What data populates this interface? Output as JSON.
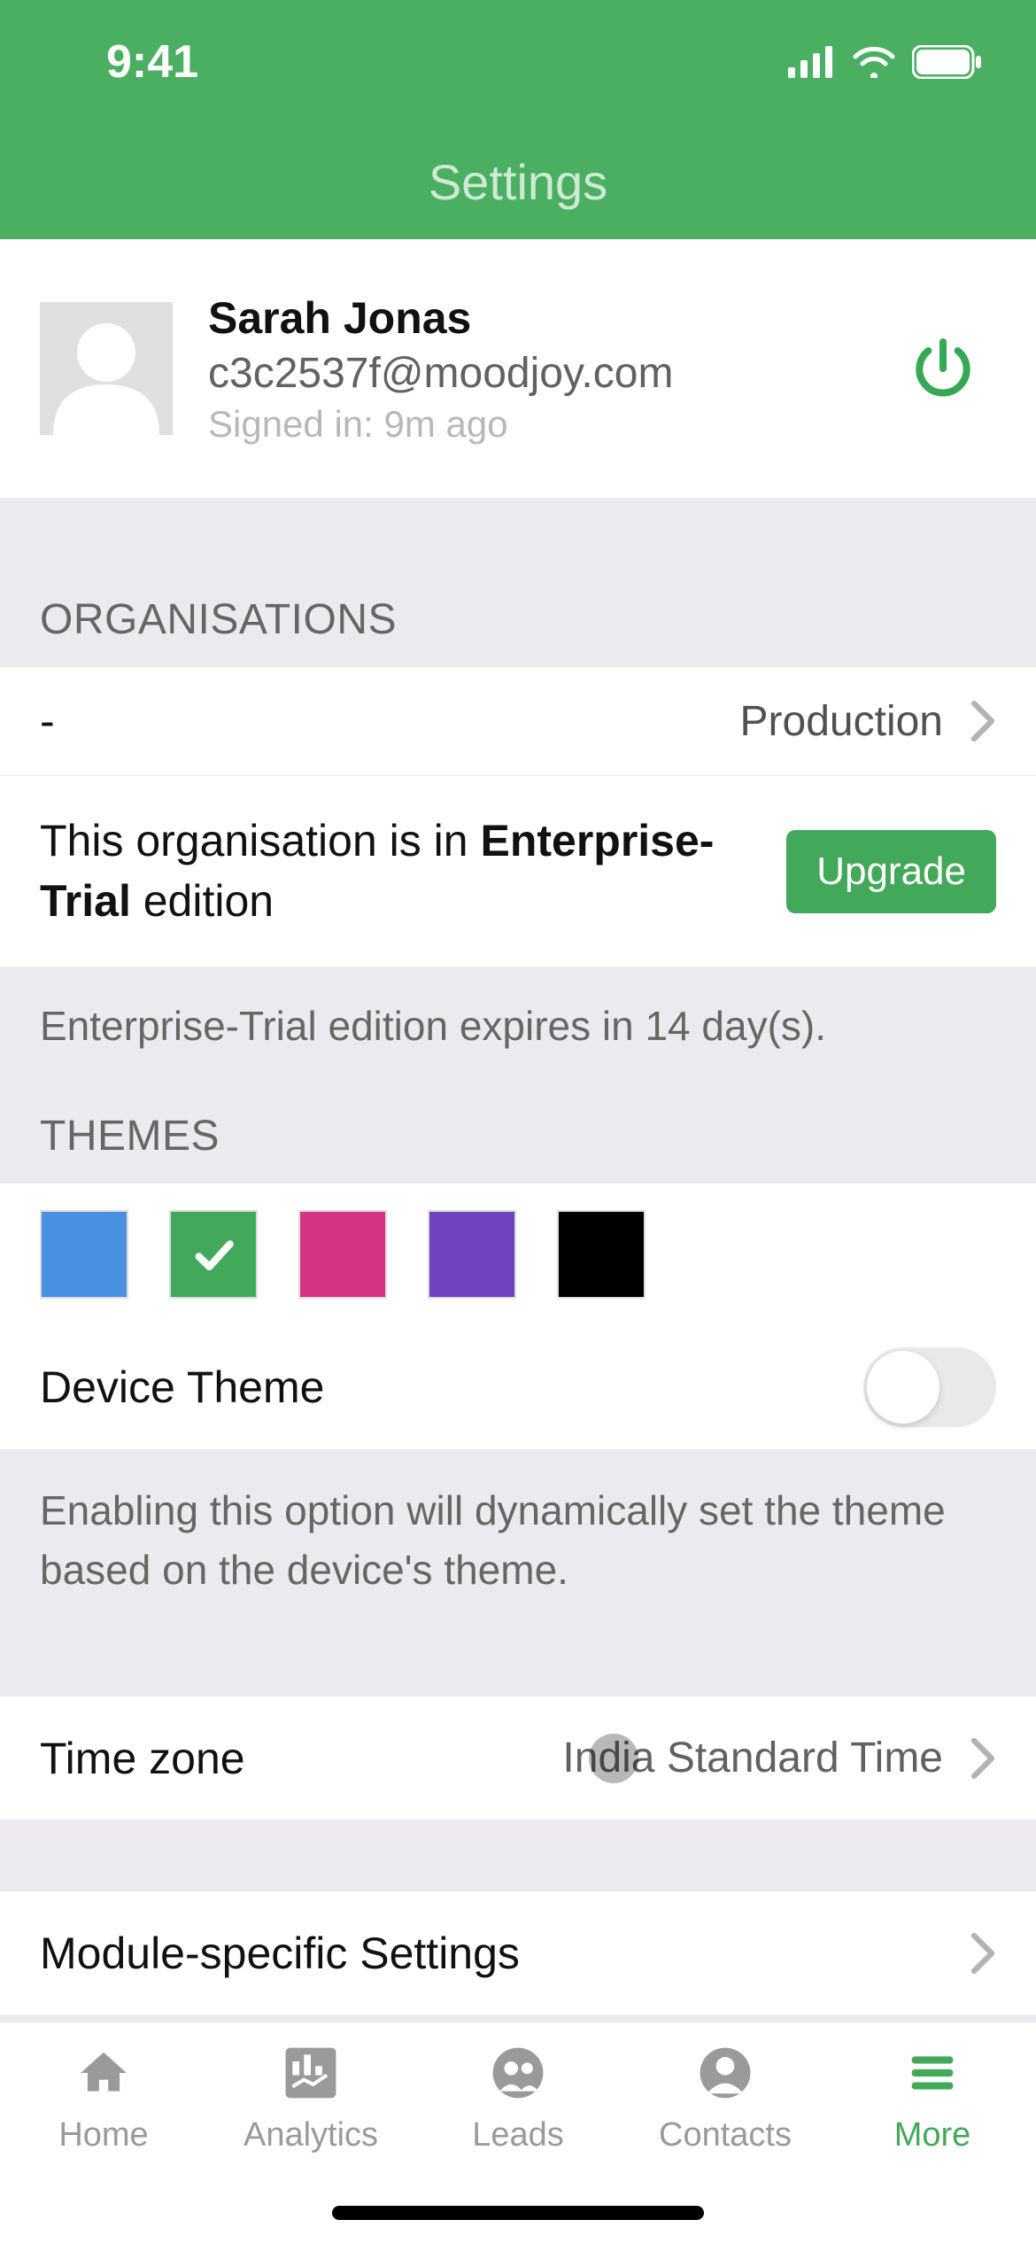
{
  "status": {
    "time": "9:41"
  },
  "header": {
    "title": "Settings"
  },
  "profile": {
    "name": "Sarah Jonas",
    "email": "c3c2537f@moodjoy.com",
    "signed_in": "Signed in: 9m ago"
  },
  "organisations": {
    "header": "ORGANISATIONS",
    "name": "-",
    "env": "Production",
    "edition_prefix": "This organisation is in ",
    "edition_name": "Enterprise-Trial",
    "edition_suffix": " edition",
    "upgrade_label": "Upgrade",
    "expiry_note": "Enterprise-Trial edition expires in 14 day(s)."
  },
  "themes": {
    "header": "THEMES",
    "colors": [
      "#4a90e2",
      "#43a95a",
      "#d63384",
      "#6f42c1",
      "#000000"
    ],
    "selected_index": 1,
    "device_theme_label": "Device Theme",
    "device_theme_on": false,
    "device_theme_note": "Enabling this option will dynamically set the theme based on the device's theme."
  },
  "timezone": {
    "label": "Time zone",
    "value": "India Standard Time"
  },
  "module_settings": {
    "label": "Module-specific Settings"
  },
  "tabs": [
    {
      "label": "Home",
      "icon": "home-icon"
    },
    {
      "label": "Analytics",
      "icon": "analytics-icon"
    },
    {
      "label": "Leads",
      "icon": "leads-icon"
    },
    {
      "label": "Contacts",
      "icon": "contacts-icon"
    },
    {
      "label": "More",
      "icon": "more-icon"
    }
  ],
  "active_tab_index": 4
}
